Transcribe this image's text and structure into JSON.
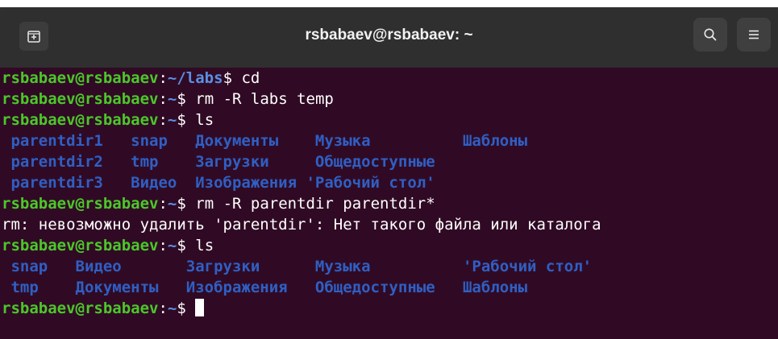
{
  "window": {
    "title": "rsbabaev@rsbabaev: ~"
  },
  "icons": {
    "new_tab": "new-tab-icon",
    "search": "search-icon",
    "menu": "hamburger-menu-icon"
  },
  "colors": {
    "background": "#300a24",
    "user": "#4cc72b",
    "path": "#5a8fe3",
    "dir": "#2f5fc4",
    "text": "#ffffff"
  },
  "terminal": {
    "lines": [
      {
        "type": "prompt",
        "user": "rsbabaev@rsbabaev",
        "sep": ":",
        "path": "~/labs",
        "sign": "$ ",
        "cmd": "cd"
      },
      {
        "type": "prompt",
        "user": "rsbabaev@rsbabaev",
        "sep": ":",
        "path": "~",
        "sign": "$ ",
        "cmd": "rm -R labs temp"
      },
      {
        "type": "prompt",
        "user": "rsbabaev@rsbabaev",
        "sep": ":",
        "path": "~",
        "sign": "$ ",
        "cmd": "ls"
      },
      {
        "type": "listing",
        "text": " parentdir1   snap   Документы    Музыка          Шаблоны"
      },
      {
        "type": "listing",
        "text": " parentdir2   tmp    Загрузки     Общедоступные"
      },
      {
        "type": "listing",
        "text": " parentdir3   Видео  Изображения 'Рабочий стол'"
      },
      {
        "type": "prompt",
        "user": "rsbabaev@rsbabaev",
        "sep": ":",
        "path": "~",
        "sign": "$ ",
        "cmd": "rm -R parentdir parentdir*"
      },
      {
        "type": "output",
        "text": "rm: невозможно удалить 'parentdir': Нет такого файла или каталога"
      },
      {
        "type": "prompt",
        "user": "rsbabaev@rsbabaev",
        "sep": ":",
        "path": "~",
        "sign": "$ ",
        "cmd": "ls"
      },
      {
        "type": "listing",
        "text": " snap   Видео       Загрузки      Музыка          'Рабочий стол'"
      },
      {
        "type": "listing",
        "text": " tmp    Документы   Изображения   Общедоступные   Шаблоны"
      },
      {
        "type": "prompt",
        "user": "rsbabaev@rsbabaev",
        "sep": ":",
        "path": "~",
        "sign": "$ ",
        "cmd": ""
      }
    ]
  }
}
